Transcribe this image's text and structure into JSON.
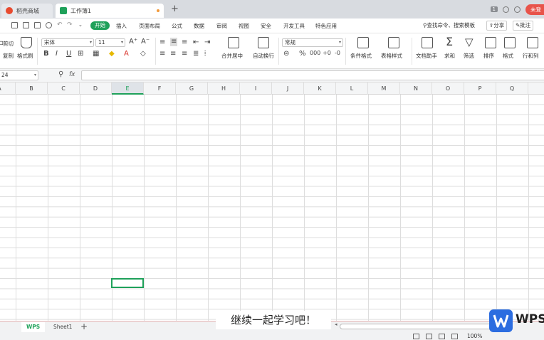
{
  "titlebar": {
    "tab_store": "稻壳商城",
    "tab_book": "工作簿1",
    "add_tab": "+",
    "badge": "1",
    "login": "未登"
  },
  "menu": {
    "start": "开始",
    "items": [
      "插入",
      "页面布局",
      "公式",
      "数据",
      "审阅",
      "视图",
      "安全",
      "开发工具",
      "特色应用"
    ],
    "search": "查找命令、搜索模板",
    "share": "分享",
    "comment": "批注"
  },
  "ribbon": {
    "cut": "剪切",
    "copy": "复制",
    "format_painter": "格式刷",
    "font": "宋体",
    "size": "11",
    "merge_center": "合并居中",
    "wrap": "自动换行",
    "number_format": "常规",
    "cond_format": "条件格式",
    "table_style": "表格样式",
    "doc_helper": "文档助手",
    "sum": "求和",
    "filter": "筛选",
    "sort": "排序",
    "format": "格式",
    "rowcol": "行和列"
  },
  "formula": {
    "namebox": "24",
    "fx": "fx",
    "value": ""
  },
  "columns": [
    "A",
    "B",
    "C",
    "D",
    "E",
    "F",
    "G",
    "H",
    "I",
    "J",
    "K",
    "L",
    "M",
    "N",
    "O",
    "P",
    "Q"
  ],
  "active_column": "E",
  "sheets": [
    "WPS",
    "Sheet1"
  ],
  "subtitle": "继续一起学习吧！",
  "status": {
    "zoom": "100%"
  },
  "logo": {
    "text": "WPS"
  },
  "colors": {
    "accent": "#1fa15a",
    "brand": "#2c6de0"
  }
}
